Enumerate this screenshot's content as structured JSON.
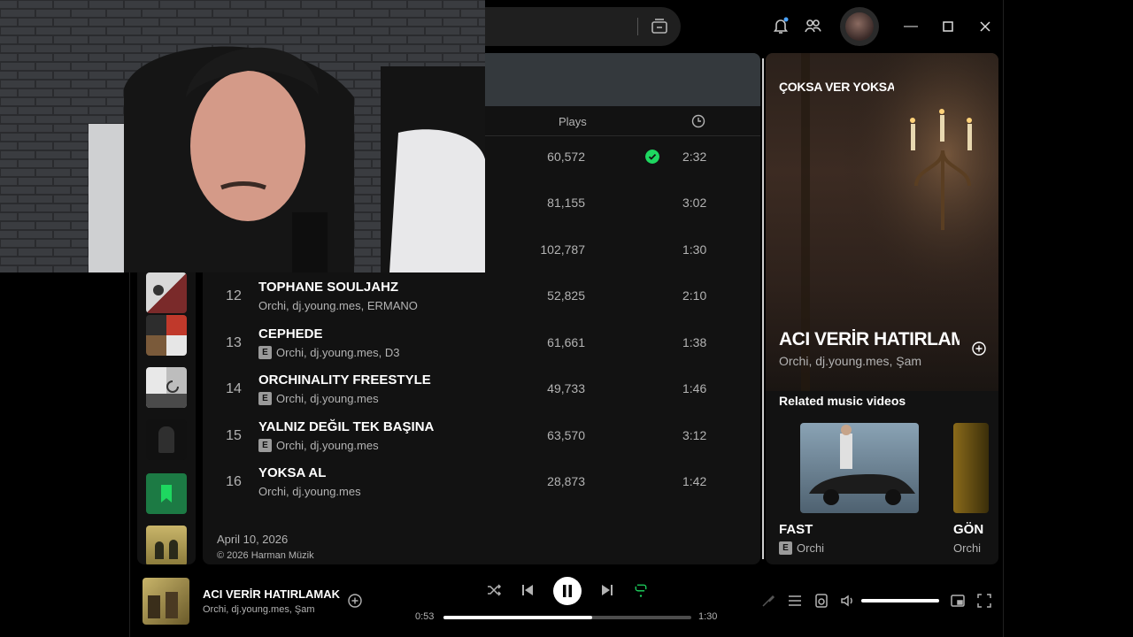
{
  "main": {
    "header": {
      "plays_label": "Plays",
      "clock_icon": "clock-icon"
    },
    "tracks": [
      {
        "num": "",
        "title": "",
        "artists": "",
        "explicit": false,
        "plays": "60,572",
        "duration": "2:32",
        "saved": true
      },
      {
        "num": "",
        "title": "",
        "artists": "",
        "explicit": false,
        "plays": "81,155",
        "duration": "3:02",
        "saved": false
      },
      {
        "num": "",
        "title": "",
        "artists": "",
        "explicit": false,
        "plays": "102,787",
        "duration": "1:30",
        "saved": false
      },
      {
        "num": "12",
        "title": "TOPHANE SOULJAHZ",
        "artists": "Orchi, dj.young.mes, ERMANO",
        "explicit": false,
        "plays": "52,825",
        "duration": "2:10",
        "saved": false
      },
      {
        "num": "13",
        "title": "CEPHEDE",
        "artists": "Orchi, dj.young.mes, D3",
        "explicit": true,
        "plays": "61,661",
        "duration": "1:38",
        "saved": false
      },
      {
        "num": "14",
        "title": "ORCHINALITY FREESTYLE",
        "artists": "Orchi, dj.young.mes",
        "explicit": true,
        "plays": "49,733",
        "duration": "1:46",
        "saved": false
      },
      {
        "num": "15",
        "title": "YALNIZ DEĞIL TEK BAŞINA",
        "artists": "Orchi, dj.young.mes",
        "explicit": true,
        "plays": "63,570",
        "duration": "3:12",
        "saved": false
      },
      {
        "num": "16",
        "title": "YOKSA AL",
        "artists": "Orchi, dj.young.mes",
        "explicit": false,
        "plays": "28,873",
        "duration": "1:42",
        "saved": false
      }
    ],
    "release_date": "April 10, 2026",
    "copyright": "© 2026 Harman Müzik"
  },
  "right_panel": {
    "header_title": "ÇOKSA VER YOKSA",
    "now_title": "ACI VERİR HATIRLAMAK",
    "now_artists": "Orchi, dj.young.mes, Şam",
    "related_heading": "Related music videos",
    "videos": [
      {
        "title": "FAST",
        "artist": "Orchi",
        "explicit": true
      },
      {
        "title": "GÖN",
        "artist": "Orchi",
        "explicit": false
      }
    ]
  },
  "player": {
    "title": "ACI VERİR HATIRLAMAK",
    "artists": "Orchi, dj.young.mes, Şam",
    "elapsed": "0:53",
    "total": "1:30",
    "progress_fraction": 0.6,
    "volume_fraction": 1.0
  },
  "colors": {
    "accent": "#1ed760",
    "bg": "#121212",
    "text_dim": "#b3b3b3"
  }
}
